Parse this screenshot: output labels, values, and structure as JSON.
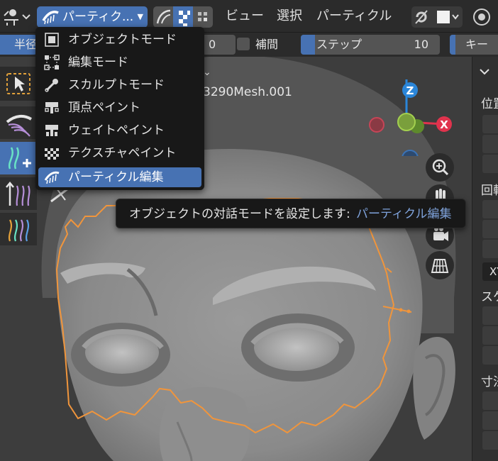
{
  "header": {
    "mode_label": "パーティク...",
    "menu_view": "ビュー",
    "menu_select": "選択",
    "menu_particle": "パーティクル"
  },
  "tool_settings": {
    "radius_label": "半径",
    "radius_value_partial": "0",
    "interpolate_label": "補間",
    "step_label": "ステップ",
    "step_value": "10",
    "key_label": "キー"
  },
  "mode_menu": {
    "items": [
      {
        "label": "オブジェクトモード",
        "icon": "object-mode-icon",
        "active": false
      },
      {
        "label": "編集モード",
        "icon": "edit-mode-icon",
        "active": false
      },
      {
        "label": "スカルプトモード",
        "icon": "sculpt-mode-icon",
        "active": false
      },
      {
        "label": "頂点ペイント",
        "icon": "vertex-paint-icon",
        "active": false
      },
      {
        "label": "ウェイトペイント",
        "icon": "weight-paint-icon",
        "active": false
      },
      {
        "label": "テクスチャペイント",
        "icon": "texture-paint-icon",
        "active": false
      },
      {
        "label": "パーティクル編集",
        "icon": "particle-edit-icon",
        "active": true
      }
    ]
  },
  "tooltip": {
    "description": "オブジェクトの対話モードを設定します:",
    "value": "パーティクル編集"
  },
  "viewport": {
    "object_name_partial": "3290Mesh.001",
    "gizmo": {
      "z_label": "Z",
      "x_label": "X"
    }
  },
  "npanel": {
    "location_label_partial": "位置",
    "rotation_label_partial": "回転",
    "rotation_mode_partial": "XY",
    "scale_label_partial": "スケ",
    "dimensions_label_partial": "寸法"
  },
  "colors": {
    "accent": "#4772b3",
    "selection_outline": "#f0953c",
    "axis_x": "#e0334d",
    "axis_y": "#8bc43b",
    "axis_z": "#2b86d9",
    "tooltip_value": "#7fa3dc"
  }
}
